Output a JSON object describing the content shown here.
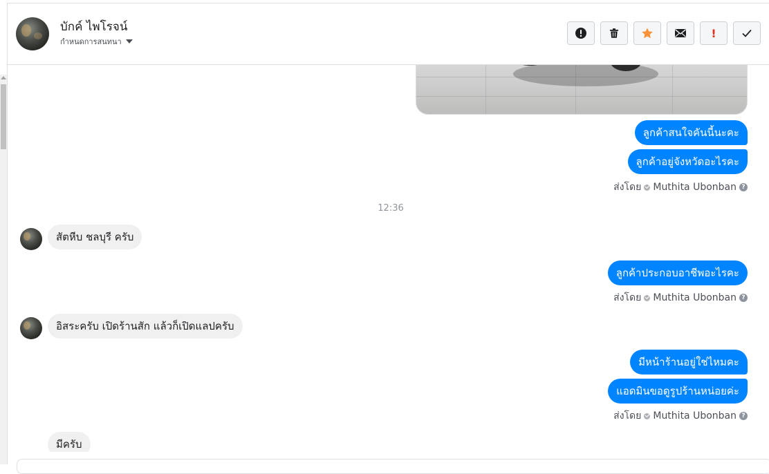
{
  "header": {
    "name": "บักค์ ไพโรจน์",
    "subtitle": "กำหนดการสนทนา",
    "actions": [
      {
        "icon": "alert-circle-icon",
        "label": ""
      },
      {
        "icon": "trash-icon",
        "label": ""
      },
      {
        "icon": "star-icon",
        "label": ""
      },
      {
        "icon": "envelope-icon",
        "label": ""
      },
      {
        "icon": "exclamation-icon",
        "label": "!"
      },
      {
        "icon": "checkmark-icon",
        "label": ""
      }
    ]
  },
  "conversation": {
    "messages": [
      {
        "dir": "out",
        "text": "ลูกค้าสนใจคันนี้นะคะ"
      },
      {
        "dir": "out",
        "text": "ลูกค้าอยู่จังหวัดอะไรคะ"
      },
      {
        "dir": "meta",
        "sent_prefix": "ส่งโดย",
        "agent": "Muthita Ubonban",
        "help": "?"
      },
      {
        "dir": "time",
        "text": "12:36"
      },
      {
        "dir": "in",
        "text": "สัตหีบ ชลบุรี ครับ"
      },
      {
        "dir": "out",
        "text": "ลูกค้าประกอบอาชีพอะไรคะ"
      },
      {
        "dir": "meta",
        "sent_prefix": "ส่งโดย",
        "agent": "Muthita Ubonban",
        "help": "?"
      },
      {
        "dir": "in",
        "text": "อิสระครับ เปิดร้านสัก แล้วก็เปิดแลปครับ"
      },
      {
        "dir": "out",
        "text": "มีหน้าร้านอยู่ใช่ไหมคะ"
      },
      {
        "dir": "out",
        "text": "แอดมินขอดูรูปร้านหน่อยค่ะ"
      },
      {
        "dir": "meta",
        "sent_prefix": "ส่งโดย",
        "agent": "Muthita Ubonban",
        "help": "?"
      },
      {
        "dir": "in",
        "text": "มีครับ"
      }
    ]
  },
  "colors": {
    "outgoing_bubble": "#0084ff",
    "incoming_bubble": "#f1f0f0",
    "star": "#f7923b",
    "warn": "#e0301e"
  }
}
